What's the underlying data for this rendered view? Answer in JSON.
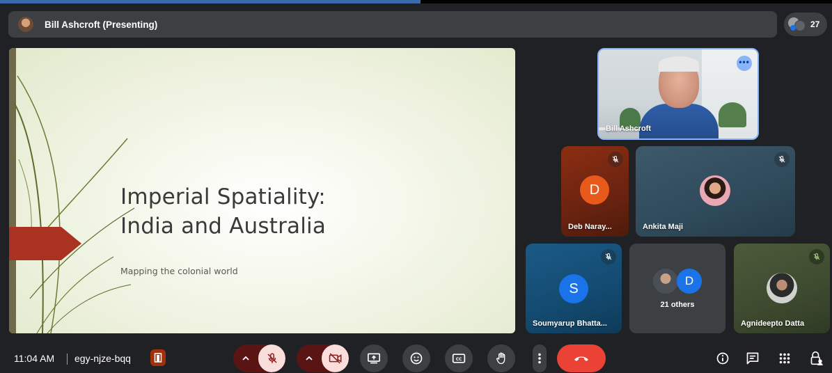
{
  "presenter_bar": {
    "name": "Bill Ashcroft (Presenting)",
    "participant_count": "27"
  },
  "slide": {
    "title_line1": "Imperial Spatiality:",
    "title_line2": "India and Australia",
    "subtitle": "Mapping the colonial world"
  },
  "tiles": {
    "bill": {
      "name": "Bill Ashcroft"
    },
    "deb": {
      "name": "Deb Naray...",
      "initial": "D",
      "avatar_color": "#e8591c"
    },
    "ankita": {
      "name": "Ankita Maji"
    },
    "soumya": {
      "name": "Soumyarup Bhatta...",
      "initial": "S",
      "avatar_color": "#1a73e8"
    },
    "others": {
      "label": "21 others",
      "initial": "D",
      "avatar_color": "#1a73e8"
    },
    "agni": {
      "name": "Agnideepto Datta"
    }
  },
  "bottom_bar": {
    "time": "11:04 AM",
    "meeting_code": "egy-njze-bqq"
  },
  "colors": {
    "end_call": "#ea4335",
    "muted_bg": "#f9dedc",
    "muted_icon": "#8c1d18",
    "speaking_outline": "#8ab4f8"
  }
}
